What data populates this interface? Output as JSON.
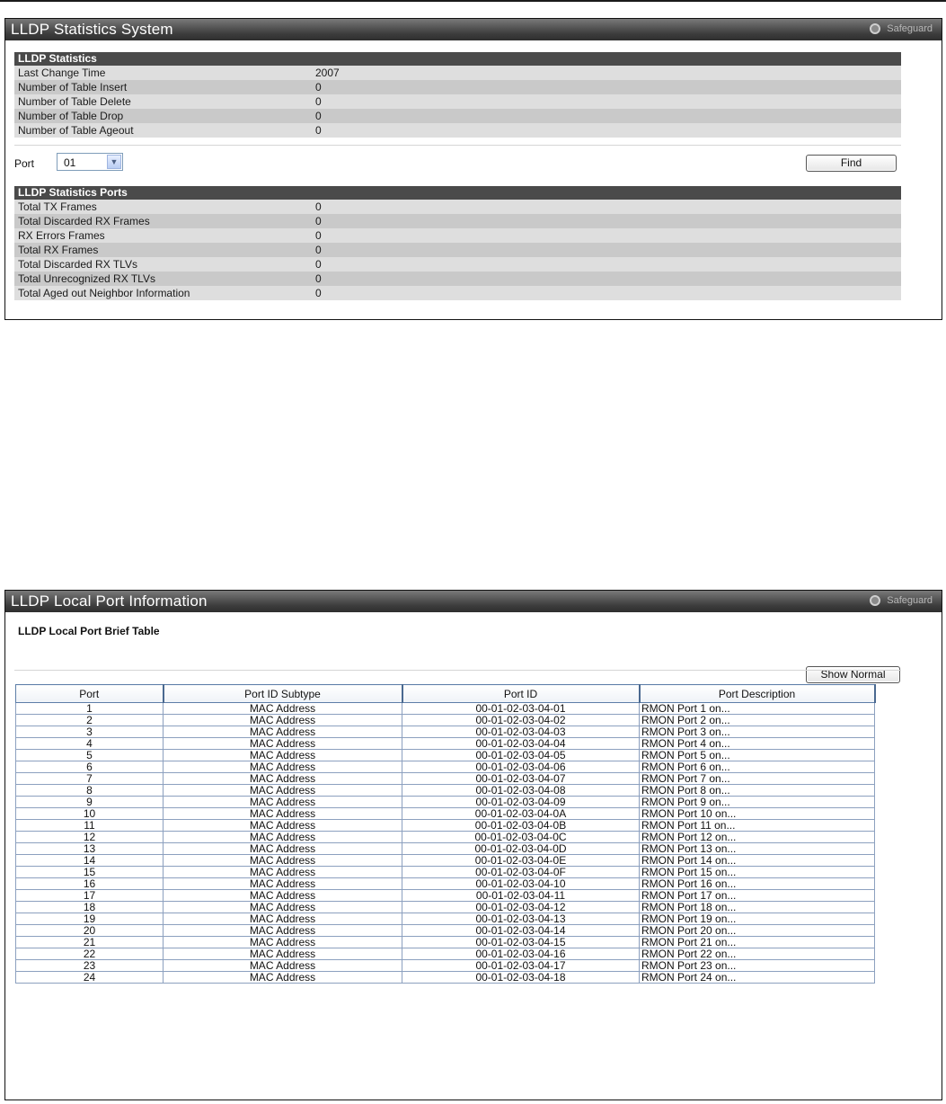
{
  "panel1": {
    "title": "LLDP Statistics System",
    "safeguard_label": "Safeguard",
    "stats_header": "LLDP Statistics",
    "stats": [
      {
        "label": "Last Change Time",
        "value": "2007"
      },
      {
        "label": "Number of Table Insert",
        "value": "0"
      },
      {
        "label": "Number of Table Delete",
        "value": "0"
      },
      {
        "label": "Number of Table Drop",
        "value": "0"
      },
      {
        "label": "Number of Table Ageout",
        "value": "0"
      }
    ],
    "port_label": "Port",
    "port_selected": "01",
    "find_label": "Find",
    "ports_header": "LLDP Statistics Ports",
    "port_stats": [
      {
        "label": "Total TX Frames",
        "value": "0"
      },
      {
        "label": "Total Discarded RX Frames",
        "value": "0"
      },
      {
        "label": "RX Errors Frames",
        "value": "0"
      },
      {
        "label": "Total RX Frames",
        "value": "0"
      },
      {
        "label": "Total Discarded RX TLVs",
        "value": "0"
      },
      {
        "label": "Total Unrecognized RX TLVs",
        "value": "0"
      },
      {
        "label": "Total Aged out Neighbor Information",
        "value": "0"
      }
    ]
  },
  "panel2": {
    "title": "LLDP Local Port Information",
    "safeguard_label": "Safeguard",
    "subtitle": "LLDP Local Port Brief Table",
    "show_normal_label": "Show Normal",
    "columns": [
      "Port",
      "Port ID Subtype",
      "Port ID",
      "Port Description"
    ],
    "rows": [
      [
        "1",
        "MAC Address",
        "00-01-02-03-04-01",
        "RMON Port 1 on..."
      ],
      [
        "2",
        "MAC Address",
        "00-01-02-03-04-02",
        "RMON Port 2 on..."
      ],
      [
        "3",
        "MAC Address",
        "00-01-02-03-04-03",
        "RMON Port 3 on..."
      ],
      [
        "4",
        "MAC Address",
        "00-01-02-03-04-04",
        "RMON Port 4 on..."
      ],
      [
        "5",
        "MAC Address",
        "00-01-02-03-04-05",
        "RMON Port 5 on..."
      ],
      [
        "6",
        "MAC Address",
        "00-01-02-03-04-06",
        "RMON Port 6 on..."
      ],
      [
        "7",
        "MAC Address",
        "00-01-02-03-04-07",
        "RMON Port 7 on..."
      ],
      [
        "8",
        "MAC Address",
        "00-01-02-03-04-08",
        "RMON Port 8 on..."
      ],
      [
        "9",
        "MAC Address",
        "00-01-02-03-04-09",
        "RMON Port 9 on..."
      ],
      [
        "10",
        "MAC Address",
        "00-01-02-03-04-0A",
        "RMON Port 10 on..."
      ],
      [
        "11",
        "MAC Address",
        "00-01-02-03-04-0B",
        "RMON Port 11 on..."
      ],
      [
        "12",
        "MAC Address",
        "00-01-02-03-04-0C",
        "RMON Port 12 on..."
      ],
      [
        "13",
        "MAC Address",
        "00-01-02-03-04-0D",
        "RMON Port 13 on..."
      ],
      [
        "14",
        "MAC Address",
        "00-01-02-03-04-0E",
        "RMON Port 14 on..."
      ],
      [
        "15",
        "MAC Address",
        "00-01-02-03-04-0F",
        "RMON Port 15 on..."
      ],
      [
        "16",
        "MAC Address",
        "00-01-02-03-04-10",
        "RMON Port 16 on..."
      ],
      [
        "17",
        "MAC Address",
        "00-01-02-03-04-11",
        "RMON Port 17 on..."
      ],
      [
        "18",
        "MAC Address",
        "00-01-02-03-04-12",
        "RMON Port 18 on..."
      ],
      [
        "19",
        "MAC Address",
        "00-01-02-03-04-13",
        "RMON Port 19 on..."
      ],
      [
        "20",
        "MAC Address",
        "00-01-02-03-04-14",
        "RMON Port 20 on..."
      ],
      [
        "21",
        "MAC Address",
        "00-01-02-03-04-15",
        "RMON Port 21 on..."
      ],
      [
        "22",
        "MAC Address",
        "00-01-02-03-04-16",
        "RMON Port 22 on..."
      ],
      [
        "23",
        "MAC Address",
        "00-01-02-03-04-17",
        "RMON Port 23 on..."
      ],
      [
        "24",
        "MAC Address",
        "00-01-02-03-04-18",
        "RMON Port 24 on..."
      ]
    ]
  }
}
